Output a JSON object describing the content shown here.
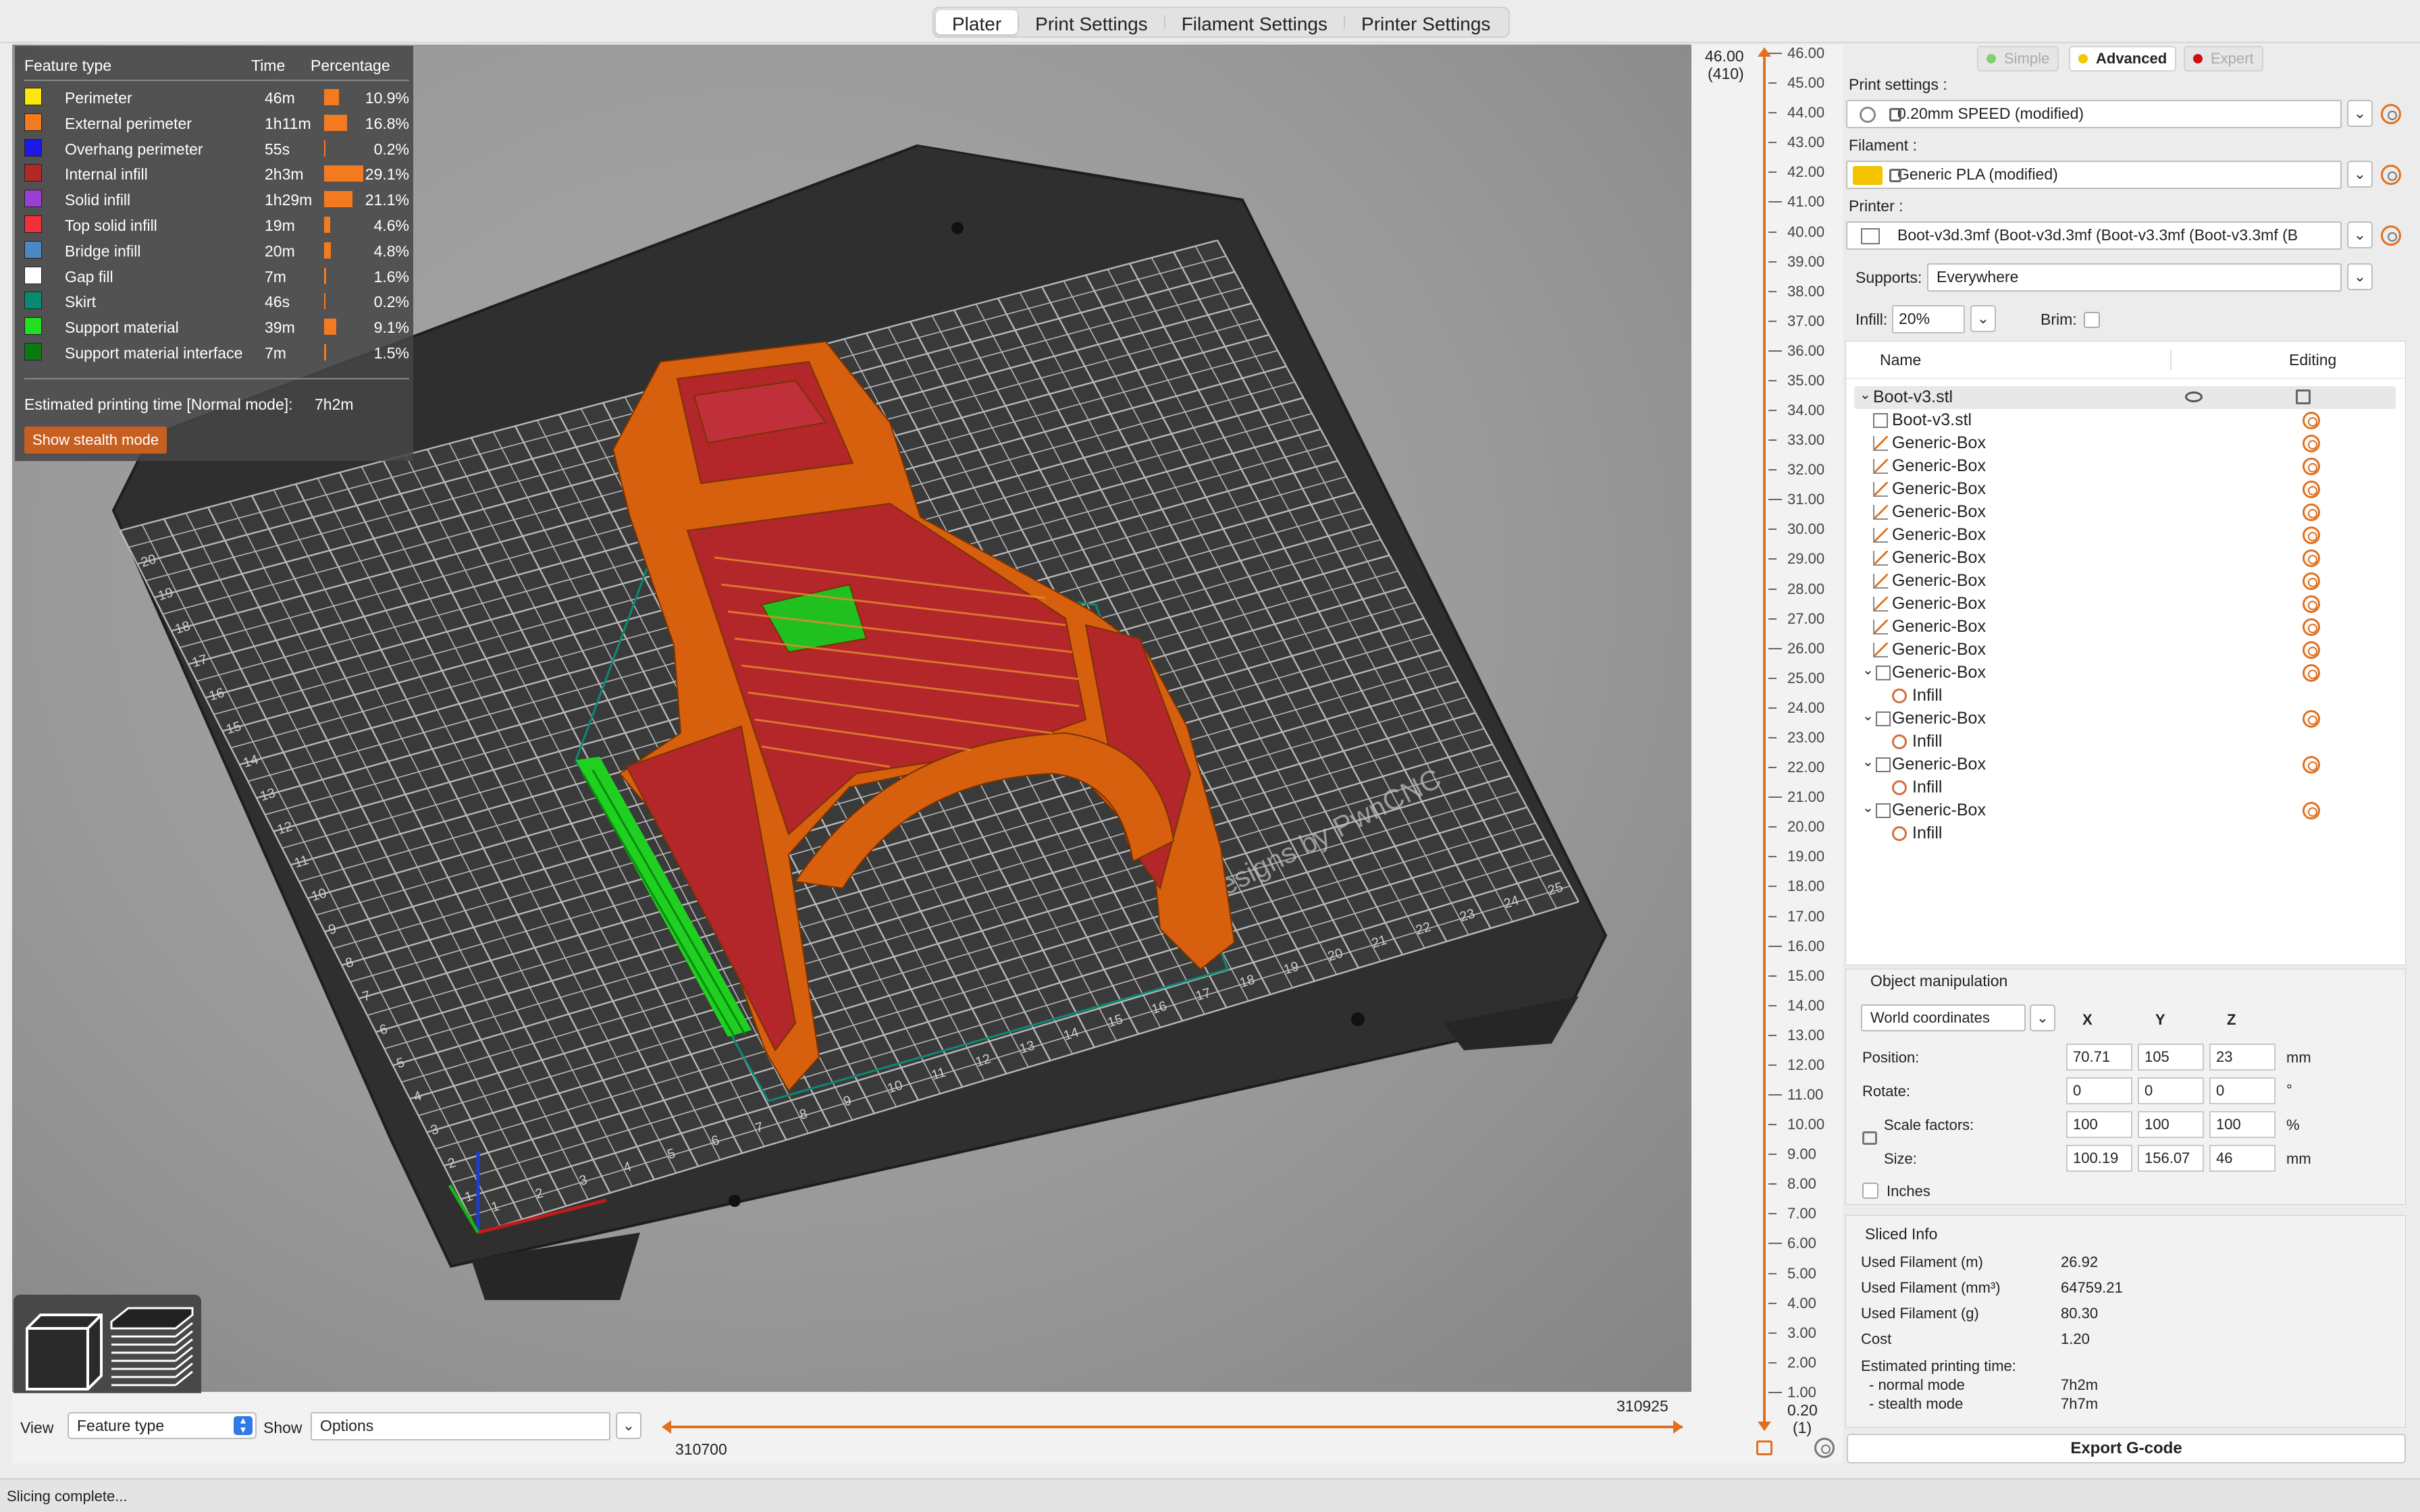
{
  "tabs": [
    "Plater",
    "Print Settings",
    "Filament Settings",
    "Printer Settings"
  ],
  "legend": {
    "headers": {
      "feature": "Feature type",
      "time": "Time",
      "percentage": "Percentage"
    },
    "rows": [
      {
        "name": "Perimeter",
        "time": "46m",
        "pct": "10.9%",
        "frac": 0.109,
        "color": "#ffe60a"
      },
      {
        "name": "External perimeter",
        "time": "1h11m",
        "pct": "16.8%",
        "frac": 0.168,
        "color": "#f47a20"
      },
      {
        "name": "Overhang perimeter",
        "time": "55s",
        "pct": "0.2%",
        "frac": 0.002,
        "color": "#1d18e8"
      },
      {
        "name": "Internal infill",
        "time": "2h3m",
        "pct": "29.1%",
        "frac": 0.291,
        "color": "#b3262a"
      },
      {
        "name": "Solid infill",
        "time": "1h29m",
        "pct": "21.1%",
        "frac": 0.211,
        "color": "#9a3fd0"
      },
      {
        "name": "Top solid infill",
        "time": "19m",
        "pct": "4.6%",
        "frac": 0.046,
        "color": "#f0303a"
      },
      {
        "name": "Bridge infill",
        "time": "20m",
        "pct": "4.8%",
        "frac": 0.048,
        "color": "#4b88c8"
      },
      {
        "name": "Gap fill",
        "time": "7m",
        "pct": "1.6%",
        "frac": 0.016,
        "color": "#ffffff"
      },
      {
        "name": "Skirt",
        "time": "46s",
        "pct": "0.2%",
        "frac": 0.002,
        "color": "#0b8a73"
      },
      {
        "name": "Support material",
        "time": "39m",
        "pct": "9.1%",
        "frac": 0.091,
        "color": "#20e020"
      },
      {
        "name": "Support material interface",
        "time": "7m",
        "pct": "1.5%",
        "frac": 0.015,
        "color": "#0a7a10"
      }
    ],
    "estimate_label": "Estimated printing time [Normal mode]:",
    "estimate_value": "7h2m",
    "stealth_button": "Show stealth mode"
  },
  "bed": {
    "watermark": "Designs by PwnCNC",
    "x_ticks": [
      "1",
      "2",
      "3",
      "4",
      "5",
      "6",
      "7",
      "8",
      "9",
      "10",
      "11",
      "12",
      "13",
      "14",
      "15",
      "16",
      "17",
      "18",
      "19",
      "20",
      "21",
      "22",
      "23",
      "24",
      "25"
    ],
    "y_ticks": [
      "1",
      "2",
      "3",
      "4",
      "5",
      "6",
      "7",
      "8",
      "9",
      "10",
      "11",
      "12",
      "13",
      "14",
      "15",
      "16",
      "17",
      "18",
      "19",
      "20"
    ]
  },
  "bottom": {
    "view_label": "View",
    "view_value": "Feature type",
    "show_label": "Show",
    "show_value": "Options",
    "hslider_min": "310700",
    "hslider_max": "310925"
  },
  "vslider": {
    "top_value": "46.00",
    "top_layer": "(410)",
    "bottom_value": "0.20",
    "bottom_layer": "(1)",
    "ticks": [
      "46.00",
      "45.00",
      "44.00",
      "43.00",
      "42.00",
      "41.00",
      "40.00",
      "39.00",
      "38.00",
      "37.00",
      "36.00",
      "35.00",
      "34.00",
      "33.00",
      "32.00",
      "31.00",
      "30.00",
      "29.00",
      "28.00",
      "27.00",
      "26.00",
      "25.00",
      "24.00",
      "23.00",
      "22.00",
      "21.00",
      "20.00",
      "19.00",
      "18.00",
      "17.00",
      "16.00",
      "15.00",
      "14.00",
      "13.00",
      "12.00",
      "11.00",
      "10.00",
      "9.00",
      "8.00",
      "7.00",
      "6.00",
      "5.00",
      "4.00",
      "3.00",
      "2.00",
      "1.00"
    ]
  },
  "modes": [
    "Simple",
    "Advanced",
    "Expert"
  ],
  "settings": {
    "print_label": "Print settings :",
    "print_value": "0.20mm SPEED (modified)",
    "filament_label": "Filament :",
    "filament_value": "Generic PLA (modified)",
    "filament_color": "#f5c400",
    "printer_label": "Printer :",
    "printer_value": "Boot-v3d.3mf (Boot-v3d.3mf (Boot-v3.3mf (Boot-v3.3mf (B",
    "supports_label": "Supports:",
    "supports_value": "Everywhere",
    "infill_label": "Infill:",
    "infill_value": "20%",
    "brim_label": "Brim:"
  },
  "tree": {
    "col_name": "Name",
    "col_editing": "Editing",
    "root": "Boot-v3.stl",
    "items": [
      {
        "label": "Boot-v3.stl",
        "kind": "part"
      },
      {
        "label": "Generic-Box",
        "kind": "modifier"
      },
      {
        "label": "Generic-Box",
        "kind": "modifier"
      },
      {
        "label": "Generic-Box",
        "kind": "modifier"
      },
      {
        "label": "Generic-Box",
        "kind": "modifier"
      },
      {
        "label": "Generic-Box",
        "kind": "modifier"
      },
      {
        "label": "Generic-Box",
        "kind": "modifier"
      },
      {
        "label": "Generic-Box",
        "kind": "modifier"
      },
      {
        "label": "Generic-Box",
        "kind": "modifier"
      },
      {
        "label": "Generic-Box",
        "kind": "modifier"
      },
      {
        "label": "Generic-Box",
        "kind": "modifier"
      },
      {
        "label": "Generic-Box",
        "kind": "group"
      },
      {
        "label": "Infill",
        "kind": "setting"
      },
      {
        "label": "Generic-Box",
        "kind": "group"
      },
      {
        "label": "Infill",
        "kind": "setting"
      },
      {
        "label": "Generic-Box",
        "kind": "group"
      },
      {
        "label": "Infill",
        "kind": "setting"
      },
      {
        "label": "Generic-Box",
        "kind": "group"
      },
      {
        "label": "Infill",
        "kind": "setting"
      }
    ]
  },
  "object_manipulation": {
    "title": "Object manipulation",
    "coords": "World coordinates",
    "axes": [
      "X",
      "Y",
      "Z"
    ],
    "position_label": "Position:",
    "position": [
      "70.71",
      "105",
      "23"
    ],
    "position_unit": "mm",
    "rotate_label": "Rotate:",
    "rotate": [
      "0",
      "0",
      "0"
    ],
    "rotate_unit": "°",
    "scale_label": "Scale factors:",
    "scale": [
      "100",
      "100",
      "100"
    ],
    "scale_unit": "%",
    "size_label": "Size:",
    "size": [
      "100.19",
      "156.07",
      "46"
    ],
    "size_unit": "mm",
    "inches_label": "Inches"
  },
  "sliced_info": {
    "title": "Sliced Info",
    "used_m_label": "Used Filament (m)",
    "used_m": "26.92",
    "used_mm3_label": "Used Filament (mm³)",
    "used_mm3": "64759.21",
    "used_g_label": "Used Filament (g)",
    "used_g": "80.30",
    "cost_label": "Cost",
    "cost": "1.20",
    "est_label": "Estimated printing time:",
    "normal_label": "- normal mode",
    "normal": "7h2m",
    "stealth_label": "- stealth mode",
    "stealth": "7h7m"
  },
  "export_button": "Export G-code",
  "status": "Slicing complete..."
}
